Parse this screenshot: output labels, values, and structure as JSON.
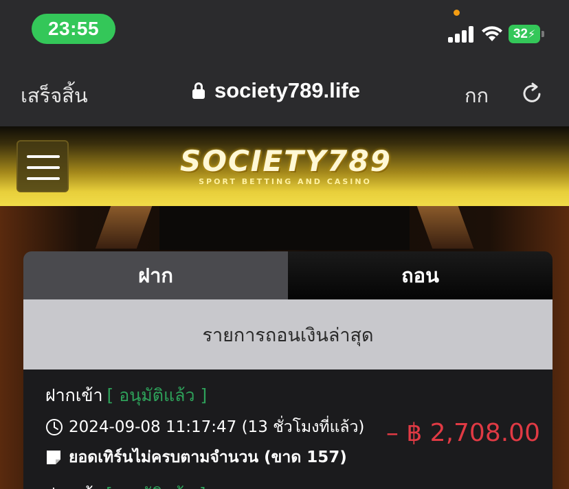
{
  "status_bar": {
    "time": "23:55",
    "battery": "32"
  },
  "browser": {
    "done_label": "เสร็จสิ้น",
    "url": "society789.life",
    "text_size_label": "กก"
  },
  "site": {
    "logo_main": "SOCIETY789",
    "logo_sub": "SPORT BETTING AND CASINO"
  },
  "tabs": [
    {
      "label": "ฝาก",
      "active": false
    },
    {
      "label": "ถอน",
      "active": true
    }
  ],
  "list_title": "รายการถอนเงินล่าสุด",
  "transactions": [
    {
      "type": "ฝากเข้า",
      "status": "[ อนุมัติแล้ว ]",
      "datetime": "2024-09-08 11:17:47 (13 ชั่วโมงที่แล้ว)",
      "amount": "– ฿ 2,708.00",
      "note": "ยอดเทิร์นไม่ครบตามจำนวน (ขาด 157)"
    },
    {
      "type": "ฝากเข้า",
      "status": "[ อนุมัติแล้ว ]"
    }
  ],
  "colors": {
    "status_green": "#2ea15a",
    "amount_red": "#e03a44",
    "gold": "#f1dc48"
  }
}
